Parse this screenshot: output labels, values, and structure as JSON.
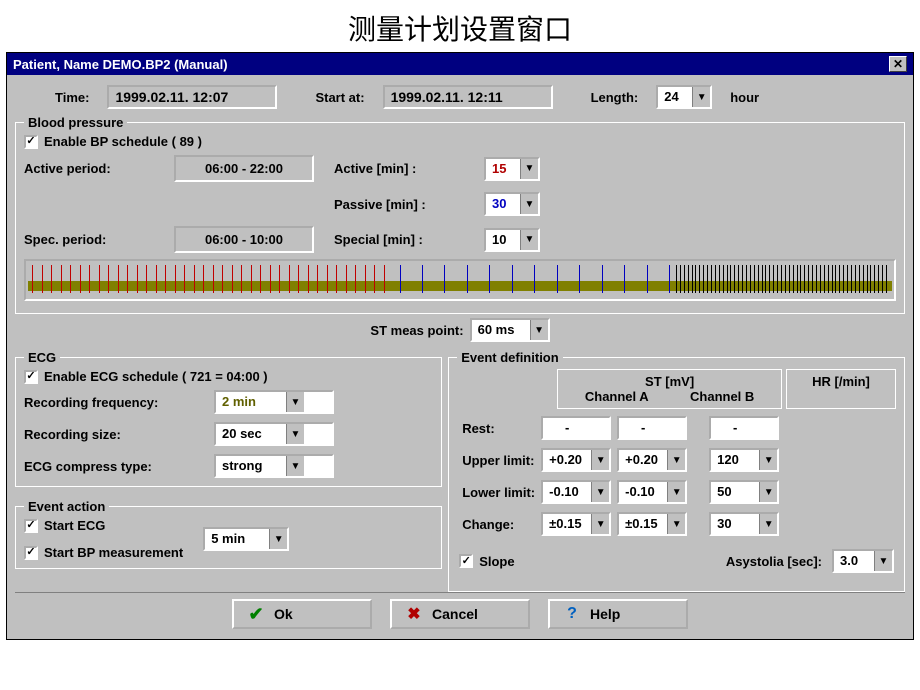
{
  "page_title": "测量计划设置窗口",
  "window_title": "Patient, Name DEMO.BP2 (Manual)",
  "header": {
    "time_label": "Time:",
    "time_value": "1999.02.11. 12:07",
    "start_label": "Start at:",
    "start_value": "1999.02.11. 12:11",
    "length_label": "Length:",
    "length_value": "24",
    "length_unit": "hour"
  },
  "bp": {
    "legend": "Blood pressure",
    "enable_label": "Enable BP schedule  ( 89 )",
    "enable_checked": true,
    "active_period_label": "Active period:",
    "active_period_value": "06:00 - 22:00",
    "active_min_label": "Active [min] :",
    "active_min_value": "15",
    "passive_min_label": "Passive [min] :",
    "passive_min_value": "30",
    "spec_period_label": "Spec. period:",
    "spec_period_value": "06:00 - 10:00",
    "special_min_label": "Special [min] :",
    "special_min_value": "10"
  },
  "st_meas": {
    "label": "ST meas point:",
    "value": "60 ms"
  },
  "ecg": {
    "legend": "ECG",
    "enable_label": "Enable ECG schedule  ( 721 = 04:00 )",
    "enable_checked": true,
    "rec_freq_label": "Recording frequency:",
    "rec_freq_value": "2 min",
    "rec_size_label": "Recording size:",
    "rec_size_value": "20 sec",
    "compress_label": "ECG compress type:",
    "compress_value": "strong"
  },
  "event_action": {
    "legend": "Event action",
    "start_ecg_label": "Start ECG",
    "start_ecg_checked": true,
    "start_bp_label": "Start BP measurement",
    "start_bp_checked": true,
    "duration_value": "5  min"
  },
  "event_def": {
    "legend": "Event definition",
    "st_header": "ST [mV]",
    "ch_a": "Channel A",
    "ch_b": "Channel B",
    "hr_header": "HR [/min]",
    "rows": {
      "rest": {
        "label": "Rest:",
        "a": "-",
        "b": "-",
        "hr": "-"
      },
      "upper": {
        "label": "Upper limit:",
        "a": "+0.20",
        "b": "+0.20",
        "hr": "120"
      },
      "lower": {
        "label": "Lower limit:",
        "a": "-0.10",
        "b": "-0.10",
        "hr": "50"
      },
      "change": {
        "label": "Change:",
        "a": "±0.15",
        "b": "±0.15",
        "hr": "30"
      }
    },
    "slope_label": "Slope",
    "slope_checked": true,
    "asys_label": "Asystolia [sec]:",
    "asys_value": "3.0"
  },
  "buttons": {
    "ok": "Ok",
    "cancel": "Cancel",
    "help": "Help"
  }
}
